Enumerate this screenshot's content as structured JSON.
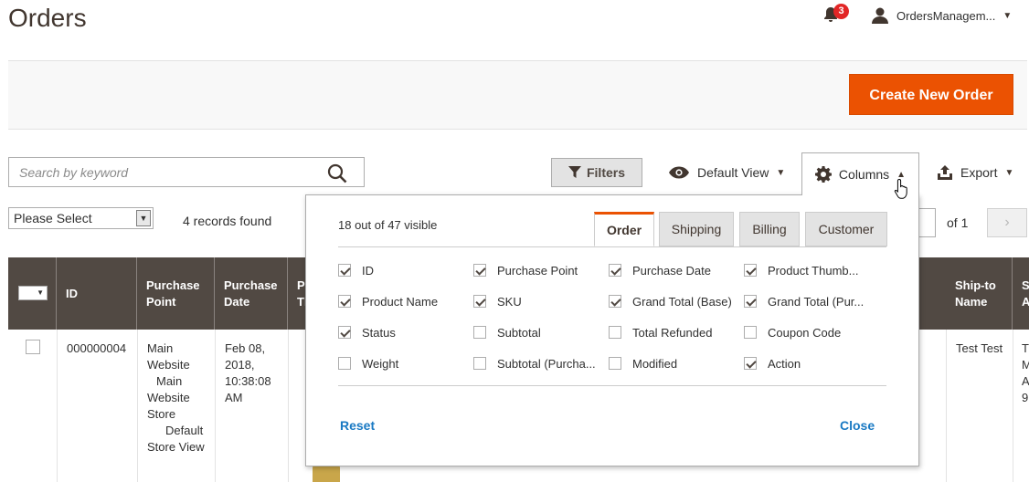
{
  "header": {
    "title": "Orders",
    "notification_count": "3",
    "user_name": "OrdersManagem..."
  },
  "actions": {
    "create_label": "Create New Order"
  },
  "toolbar": {
    "search_placeholder": "Search by keyword",
    "filters_label": "Filters",
    "view_label": "Default View",
    "columns_label": "Columns",
    "export_label": "Export"
  },
  "massaction": {
    "selected": "Please Select"
  },
  "records": "4 records found",
  "pager": {
    "of_label": "of 1"
  },
  "grid": {
    "headers": [
      "ID",
      "Purchase Point",
      "Purchase Date",
      "P Th",
      "Ship-to Name",
      "S A"
    ],
    "row": {
      "id": "000000004",
      "purchase_point": [
        "Main",
        "Website",
        "Main",
        "Website",
        "Store",
        "Default",
        "Store View"
      ],
      "purchase_date": [
        "Feb 08,",
        "2018,",
        "10:38:08",
        "AM"
      ],
      "ship_to": "Test Test",
      "partial": [
        "T",
        "M",
        "A",
        "9"
      ]
    }
  },
  "columns_panel": {
    "visible_count": "18 out of 47 visible",
    "tabs": [
      "Order",
      "Shipping",
      "Billing",
      "Customer"
    ],
    "active_tab": "Order",
    "options": [
      {
        "label": "ID",
        "checked": true
      },
      {
        "label": "Purchase Point",
        "checked": true
      },
      {
        "label": "Purchase Date",
        "checked": true
      },
      {
        "label": "Product Thumb...",
        "checked": true
      },
      {
        "label": "Product Name",
        "checked": true
      },
      {
        "label": "SKU",
        "checked": true
      },
      {
        "label": "Grand Total (Base)",
        "checked": true
      },
      {
        "label": "Grand Total (Pur...",
        "checked": true
      },
      {
        "label": "Status",
        "checked": true
      },
      {
        "label": "Subtotal",
        "checked": false
      },
      {
        "label": "Total Refunded",
        "checked": false
      },
      {
        "label": "Coupon Code",
        "checked": false
      },
      {
        "label": "Weight",
        "checked": false
      },
      {
        "label": "Subtotal (Purcha...",
        "checked": false
      },
      {
        "label": "Modified",
        "checked": false
      },
      {
        "label": "Action",
        "checked": true
      }
    ],
    "reset_label": "Reset",
    "close_label": "Close"
  },
  "colors": {
    "accent": "#eb5202",
    "header_bg": "#514943",
    "link": "#1979c3",
    "badge": "#e22626"
  }
}
